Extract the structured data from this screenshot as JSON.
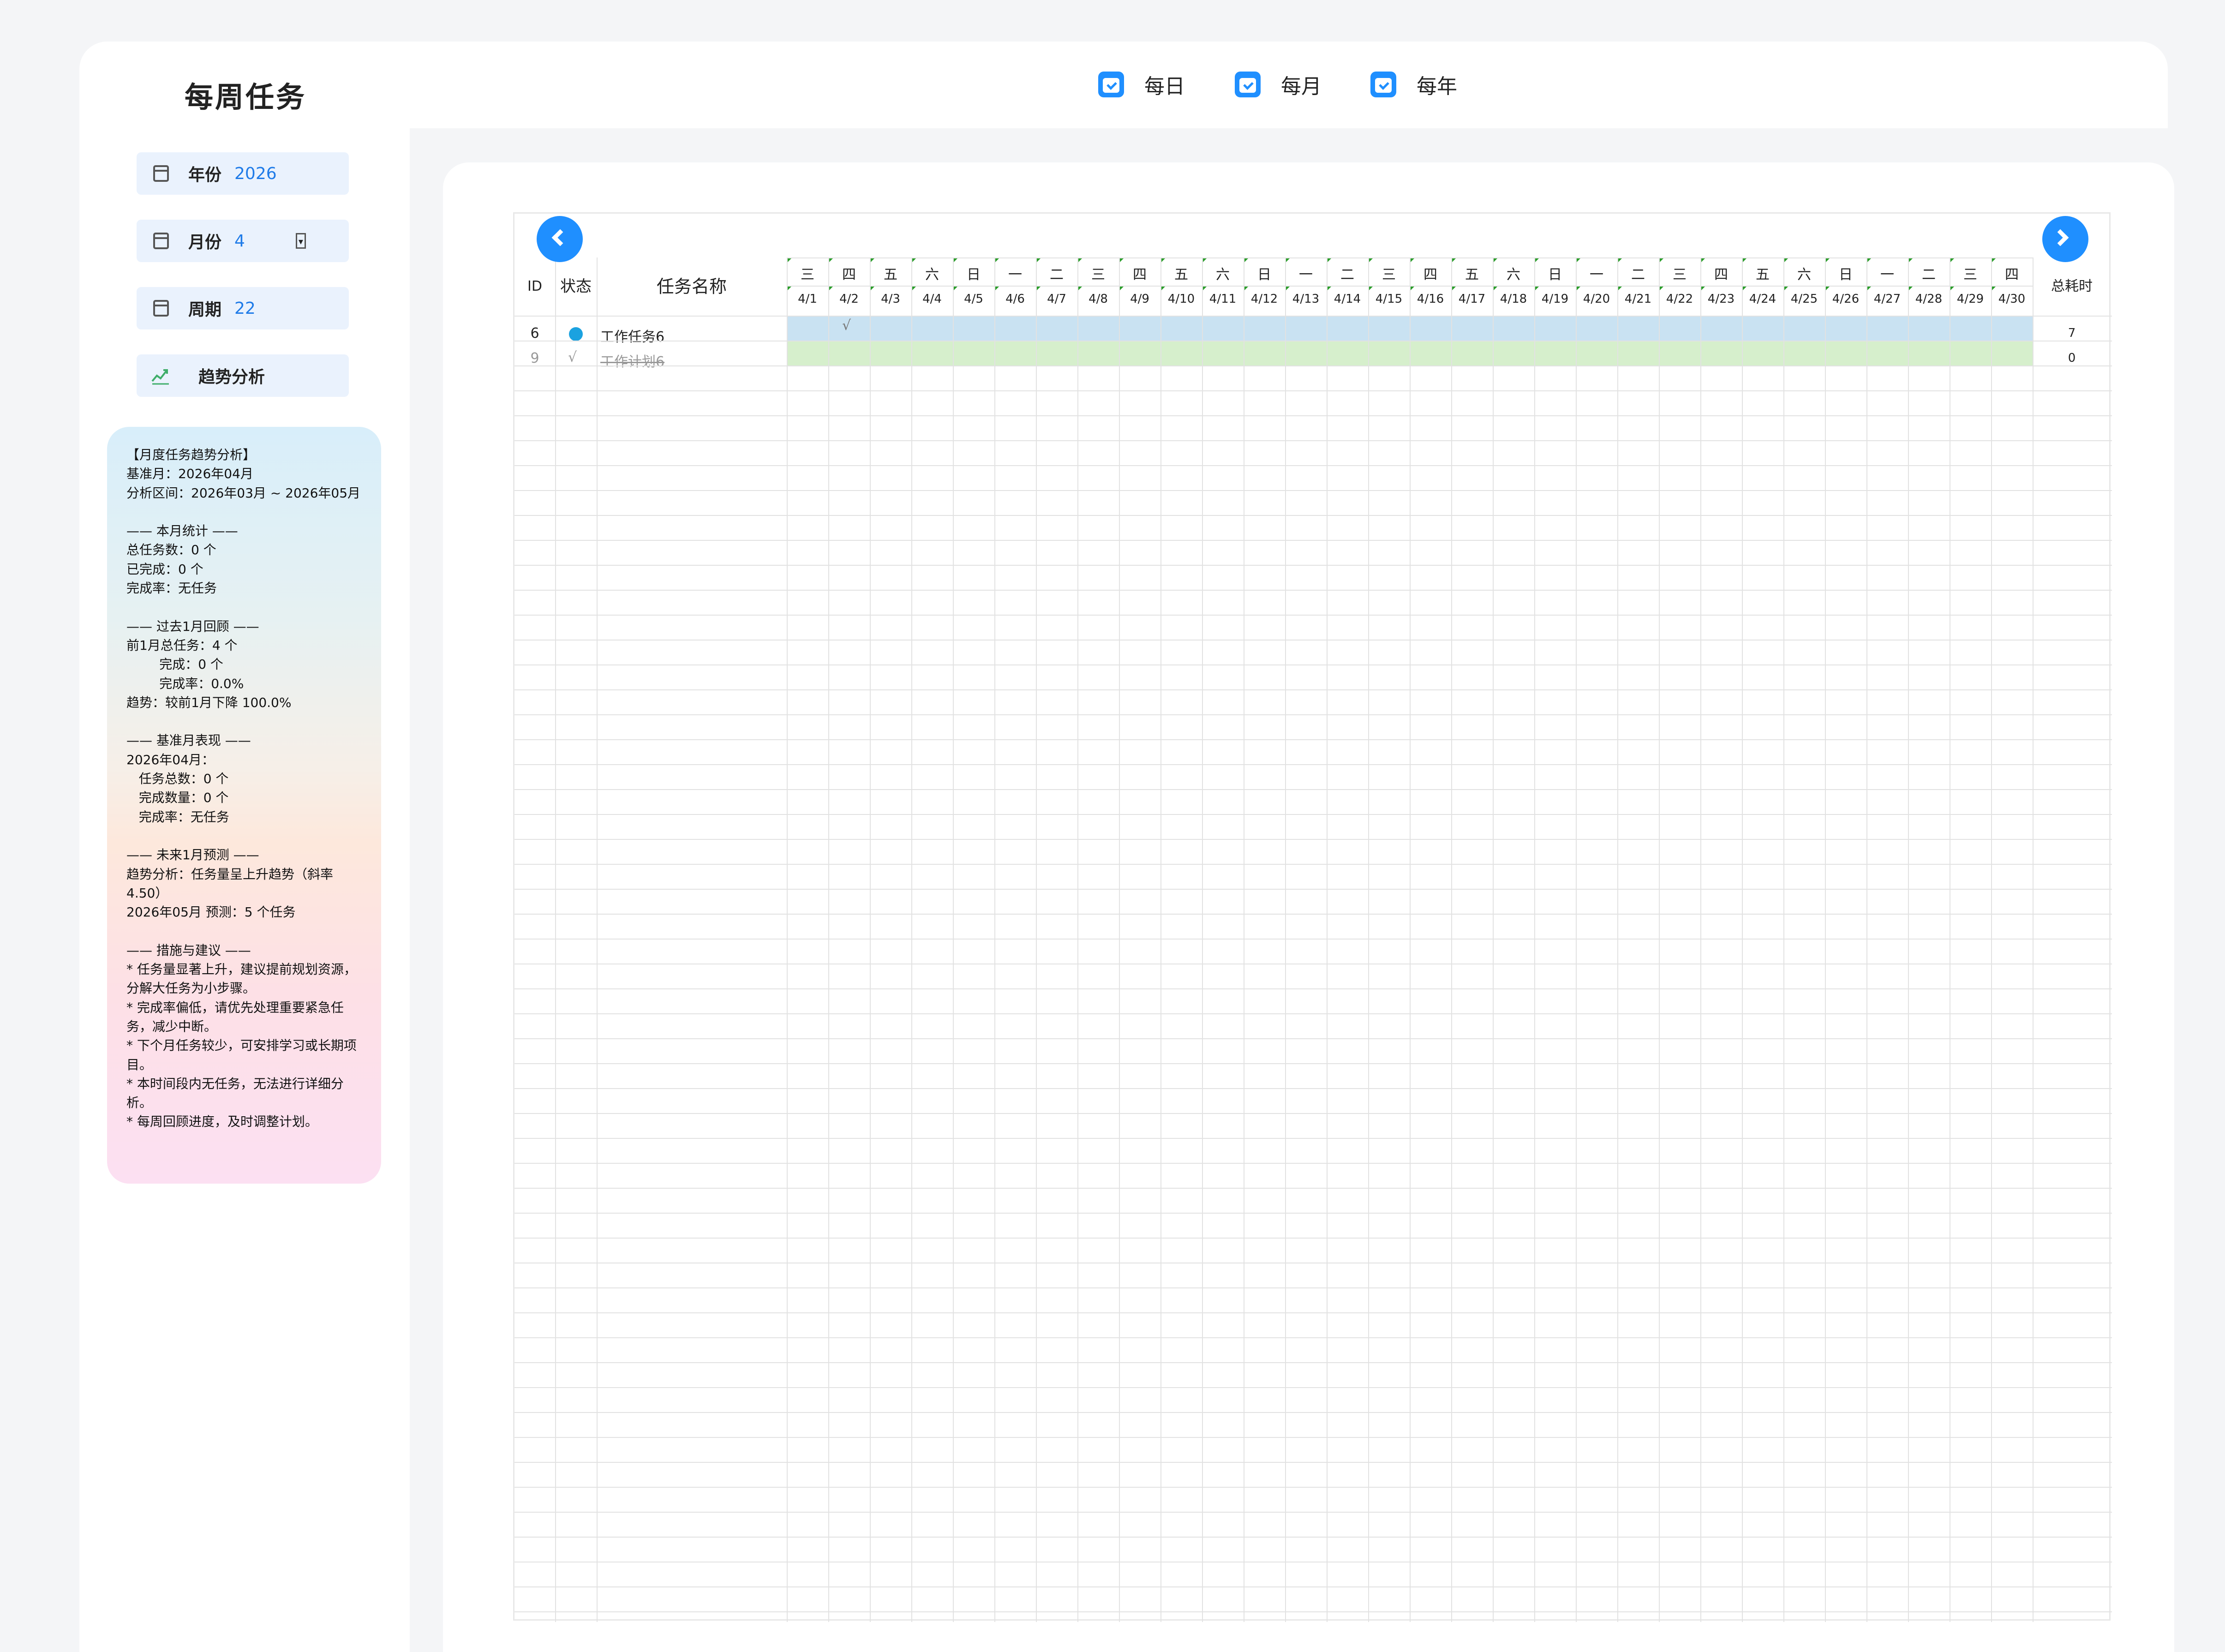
{
  "app": {
    "title": "每周任务"
  },
  "nav": [
    {
      "label": "每日"
    },
    {
      "label": "每月"
    },
    {
      "label": "每年"
    }
  ],
  "controls": {
    "year": {
      "label": "年份",
      "value": "2026"
    },
    "month": {
      "label": "月份",
      "value": "4"
    },
    "week": {
      "label": "周期",
      "value": "22"
    },
    "trend": {
      "label": "趋势分析"
    }
  },
  "analysis": {
    "text": "【月度任务趋势分析】\n基准月：2026年04月\n分析区间：2026年03月 ~ 2026年05月\n\n—— 本月统计 ——\n总任务数：0 个\n已完成：0 个\n完成率：无任务\n\n—— 过去1月回顾 ——\n前1月总任务：4 个\n        完成：0 个\n        完成率：0.0%\n趋势：较前1月下降 100.0%\n\n—— 基准月表现 ——\n2026年04月：\n   任务总数：0 个\n   完成数量：0 个\n   完成率：无任务\n\n—— 未来1月预测 ——\n趋势分析：任务量呈上升趋势（斜率 4.50）\n2026年05月 预测：5 个任务\n\n—— 措施与建议 ——\n* 任务量显著上升，建议提前规划资源，分解大任务为小步骤。\n* 完成率偏低，请优先处理重要紧急任务，减少中断。\n* 下个月任务较少，可安排学习或长期项目。\n* 本时间段内无任务，无法进行详细分析。\n* 每周回顾进度，及时调整计划。"
  },
  "gantt": {
    "headers": {
      "id": "ID",
      "status": "状态",
      "name": "任务名称",
      "total": "总耗时"
    },
    "weekdays": [
      "三",
      "四",
      "五",
      "六",
      "日",
      "一",
      "二",
      "三",
      "四",
      "五",
      "六",
      "日",
      "一",
      "二",
      "三",
      "四",
      "五",
      "六",
      "日",
      "一",
      "二",
      "三",
      "四",
      "五",
      "六",
      "日",
      "一",
      "二",
      "三",
      "四"
    ],
    "dates": [
      "4/1",
      "4/2",
      "4/3",
      "4/4",
      "4/5",
      "4/6",
      "4/7",
      "4/8",
      "4/9",
      "4/10",
      "4/11",
      "4/12",
      "4/13",
      "4/14",
      "4/15",
      "4/16",
      "4/17",
      "4/18",
      "4/19",
      "4/20",
      "4/21",
      "4/22",
      "4/23",
      "4/24",
      "4/25",
      "4/26",
      "4/27",
      "4/28",
      "4/29",
      "4/30"
    ],
    "rows": [
      {
        "id": "6",
        "status": "in-progress",
        "name": "工作任务6",
        "mark": "√",
        "mark_day": "4/2",
        "total": "7",
        "bar_color": "#c9e2f2"
      },
      {
        "id": "9",
        "status": "done",
        "status_mark": "√",
        "name": "工作计划6",
        "total": "0",
        "bar_color": "#d6efcc"
      }
    ],
    "colors": {
      "accent": "#1f8fff",
      "status_dot": "#1ba2e0"
    }
  }
}
